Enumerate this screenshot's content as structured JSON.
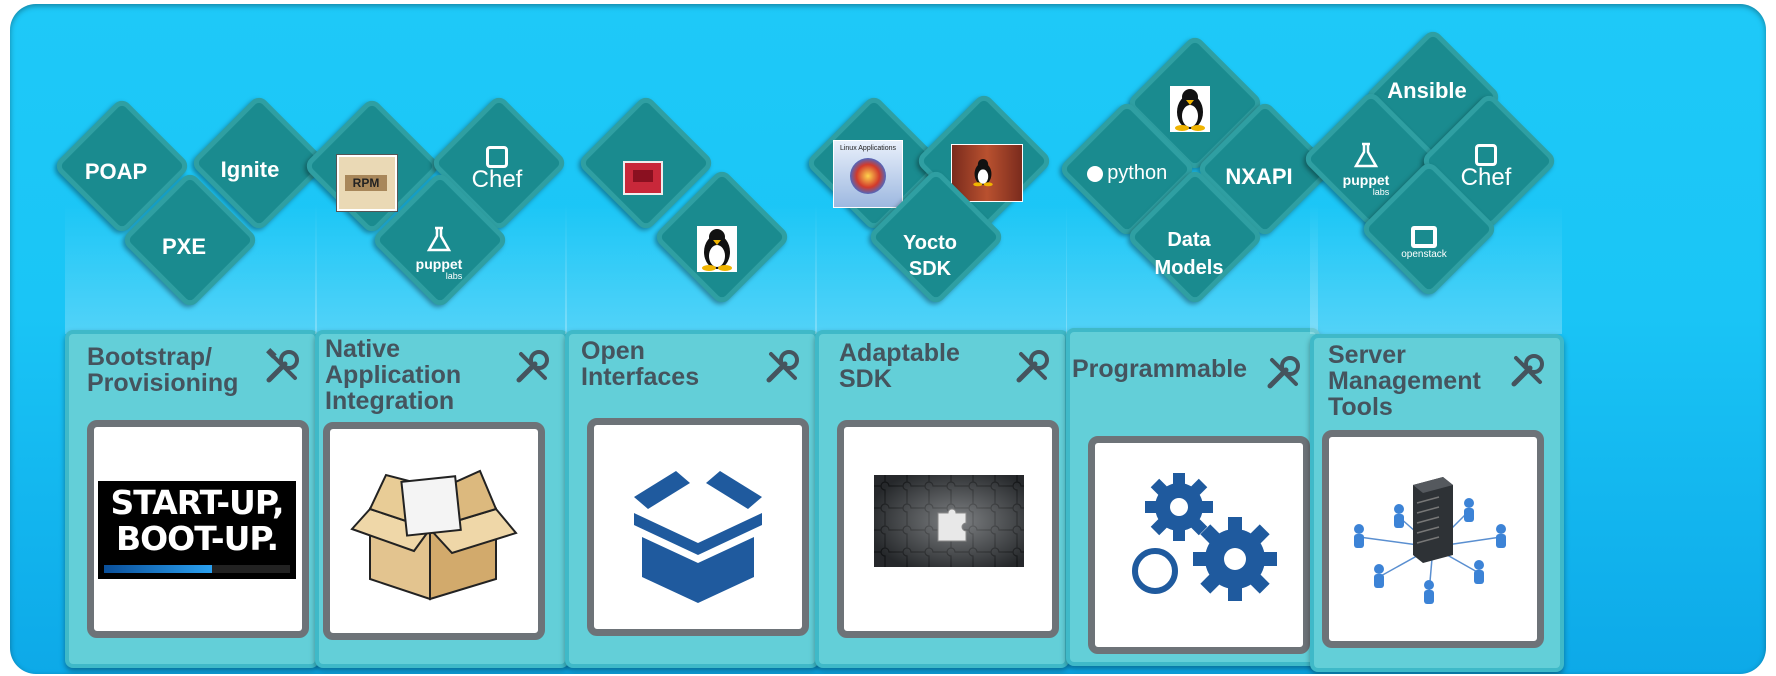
{
  "colors": {
    "background": "#1ac5f6",
    "card": "#63cfd8",
    "diamond": "#1a8b8f",
    "title_text": "#45545e",
    "icon_blue": "#1f5a9e"
  },
  "columns": [
    {
      "title": "Bootstrap/\nProvisioning",
      "diamonds": [
        "POAP",
        "Ignite",
        "PXE"
      ],
      "image": "start-up-boot-up-logo",
      "image_text": [
        "START-UP,",
        "BOOT-UP."
      ]
    },
    {
      "title": "Native\nApplication\nIntegration",
      "diamonds": [
        "RPM",
        "Chef",
        "puppet"
      ],
      "image": "open-cardboard-box-icon"
    },
    {
      "title": "Open\nInterfaces",
      "diamonds": [
        "chip-icon",
        "tux-icon"
      ],
      "image": "open-box-icon"
    },
    {
      "title": "Adaptable\nSDK",
      "diamonds": [
        "Linux Applications",
        "container-icon",
        "Yocto\nSDK"
      ],
      "image": "puzzle-icon"
    },
    {
      "title": "Programmable",
      "diamonds": [
        "tux-icon",
        "python",
        "NXAPI",
        "Data\nModels"
      ],
      "image": "gears-icon"
    },
    {
      "title": "Server\nManagement\nTools",
      "diamonds": [
        "Ansible",
        "puppet",
        "Chef",
        "openstack"
      ],
      "image": "server-network-icon"
    }
  ],
  "logos": {
    "rpm": "RPM",
    "chef": "Chef",
    "puppet": "puppet",
    "puppet_sub": "labs",
    "python": "python",
    "linux_apps": "Linux Applications",
    "openstack": "openstack"
  }
}
